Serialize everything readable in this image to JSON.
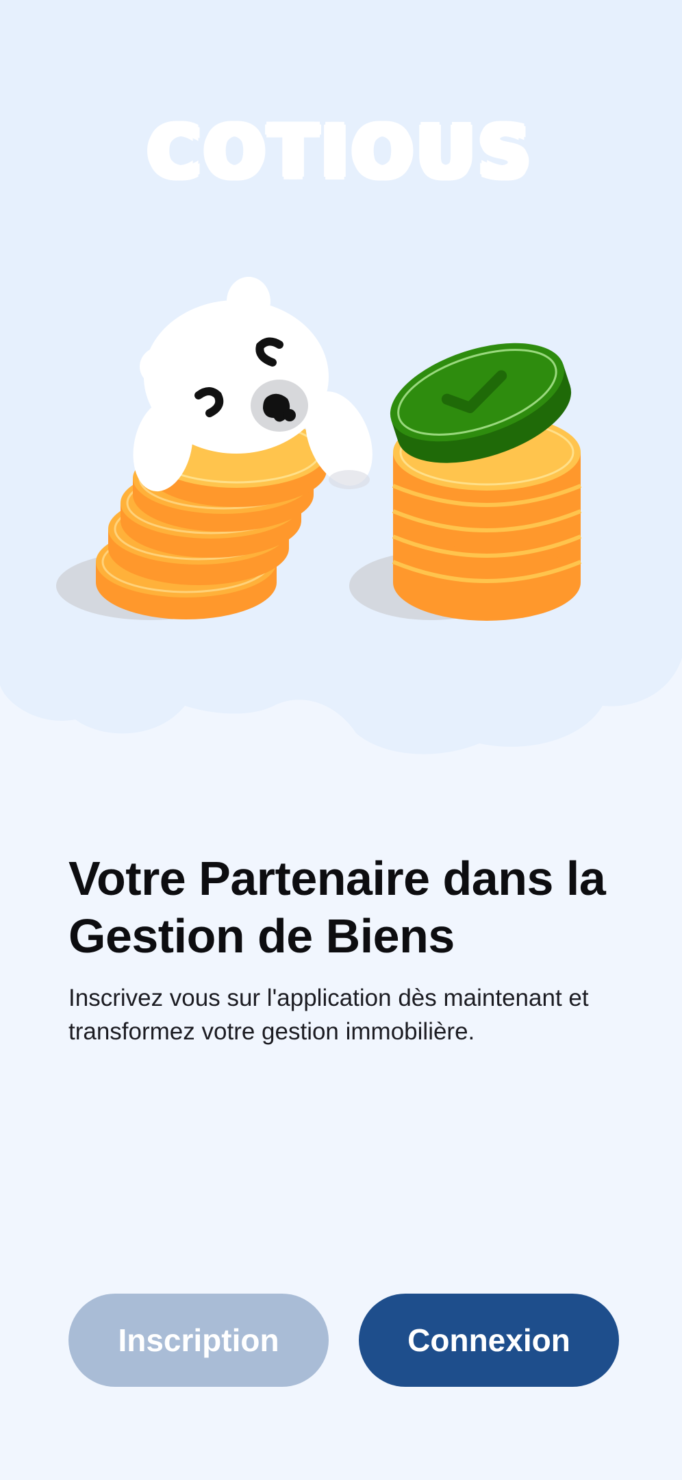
{
  "app": {
    "logo_text": "COTIOUS"
  },
  "onboarding": {
    "title": "Votre Partenaire dans la Gestion de Biens",
    "subtitle": "Inscrivez vous sur l'application dès maintenant et transformez votre gestion immobilière."
  },
  "actions": {
    "signup_label": "Inscription",
    "login_label": "Connexion"
  },
  "illustration": {
    "icons": [
      "bear-mascot-icon",
      "coin-stack-icon",
      "check-coin-icon"
    ]
  },
  "colors": {
    "background": "#f1f6fe",
    "hero_cloud": "#e7f1fd",
    "coin_orange": "#ff9a2e",
    "coin_top": "#ffc44d",
    "check_coin": "#2e8c0e",
    "signup_button": "#a9bcd6",
    "login_button": "#1e4e8c"
  }
}
